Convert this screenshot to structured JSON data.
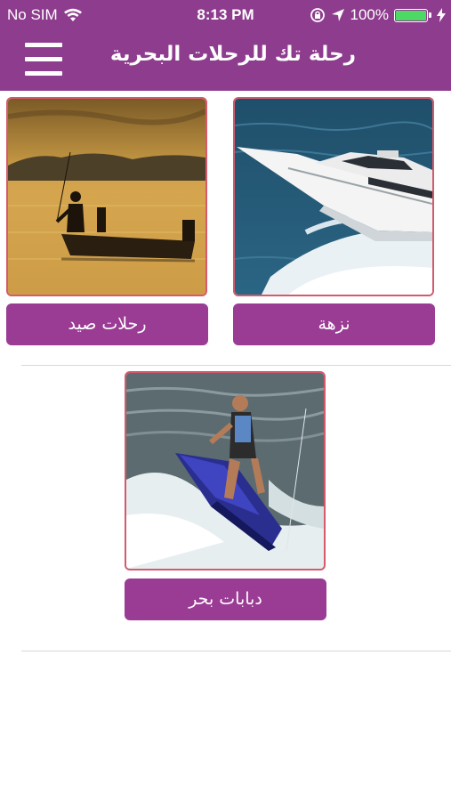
{
  "status": {
    "carrier": "No SIM",
    "time": "8:13 PM",
    "battery": "100%",
    "battery_level_percent": 100
  },
  "header": {
    "title": "رحلة تك للرحلات البحرية"
  },
  "categories": [
    {
      "label": "نزهة",
      "image": "yacht"
    },
    {
      "label": "رحلات صيد",
      "image": "fishing-boat"
    },
    {
      "label": "دبابات بحر",
      "image": "jet-ski"
    }
  ],
  "colors": {
    "primary": "#8e3c8e",
    "button": "#9a3b94",
    "image_border": "#d45a6c",
    "battery_green": "#4cd964"
  }
}
